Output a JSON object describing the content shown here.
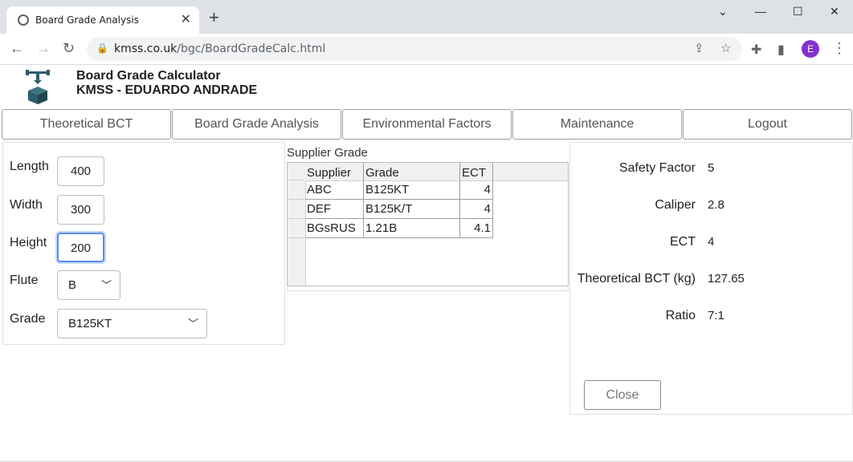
{
  "browser": {
    "tab_title": "Board Grade Analysis",
    "url_host": "kmss.co.uk",
    "url_path": "/bgc/BoardGradeCalc.html",
    "avatar_letter": "E"
  },
  "app": {
    "title": "Board Grade Calculator",
    "user": "KMSS - EDUARDO ANDRADE"
  },
  "nav": {
    "tabs": [
      "Theoretical BCT",
      "Board Grade Analysis",
      "Environmental Factors",
      "Maintenance",
      "Logout"
    ]
  },
  "inputs": {
    "length_label": "Length",
    "length_value": "400",
    "width_label": "Width",
    "width_value": "300",
    "height_label": "Height",
    "height_value": "200",
    "flute_label": "Flute",
    "flute_value": "B",
    "grade_label": "Grade",
    "grade_value": "B125KT"
  },
  "supplier": {
    "caption": "Supplier Grade",
    "columns": [
      "Supplier",
      "Grade",
      "ECT"
    ],
    "rows": [
      [
        "ABC",
        "B125KT",
        "4"
      ],
      [
        "DEF",
        "B125K/T",
        "4"
      ],
      [
        "BGsRUS",
        "1.21B",
        "4.1"
      ]
    ]
  },
  "results": {
    "safety_factor_label": "Safety Factor",
    "safety_factor_value": "5",
    "caliper_label": "Caliper",
    "caliper_value": "2.8",
    "ect_label": "ECT",
    "ect_value": "4",
    "bct_label": "Theoretical BCT (kg)",
    "bct_value": "127.65",
    "ratio_label": "Ratio",
    "ratio_value": "7:1"
  },
  "close_label": "Close"
}
